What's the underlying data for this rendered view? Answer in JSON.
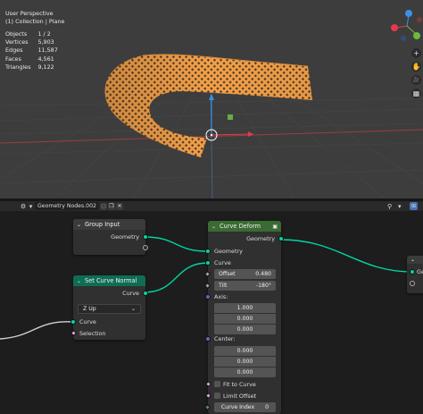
{
  "viewport": {
    "view_name": "User Perspective",
    "collection": "(1) Collection | Plane",
    "stats": [
      {
        "label": "Objects",
        "value": "1 / 2"
      },
      {
        "label": "Vertices",
        "value": "5,903"
      },
      {
        "label": "Edges",
        "value": "11,587"
      },
      {
        "label": "Faces",
        "value": "4,561"
      },
      {
        "label": "Triangles",
        "value": "9,122"
      }
    ],
    "tools": {
      "zoom": "+",
      "pan": "✋",
      "camera": "🎥",
      "grid": "▦"
    }
  },
  "node_editor": {
    "tree_name": "Geometry Nodes.002",
    "nodes": {
      "group_input": {
        "title": "Group Input",
        "out_geometry": "Geometry"
      },
      "set_curve_normal": {
        "title": "Set Curve Normal",
        "out_curve": "Curve",
        "mode": "Z Up",
        "in_curve": "Curve",
        "in_selection": "Selection"
      },
      "curve_deform": {
        "title": "Curve Deform",
        "out_geometry": "Geometry",
        "in_geometry": "Geometry",
        "in_curve": "Curve",
        "offset_label": "Offset",
        "offset_value": "0.480",
        "tilt_label": "Tilt",
        "tilt_value": "-180°",
        "axis_label": "Axis:",
        "axis": [
          "1.000",
          "0.000",
          "0.000"
        ],
        "center_label": "Center:",
        "center": [
          "0.000",
          "0.000",
          "0.000"
        ],
        "fit_to_curve": "Fit to Curve",
        "limit_offset": "Limit Offset",
        "curve_index_label": "Curve Index",
        "curve_index_value": "0"
      },
      "output_partial": {
        "label": "Ge"
      }
    },
    "colors": {
      "geometry_socket": "#00d6a3",
      "vector_socket": "#6363c7",
      "curve_deform_header": "#3a6b32",
      "set_curve_normal_header": "#0f6d56",
      "group_input_header": "#3b3b3b"
    }
  }
}
